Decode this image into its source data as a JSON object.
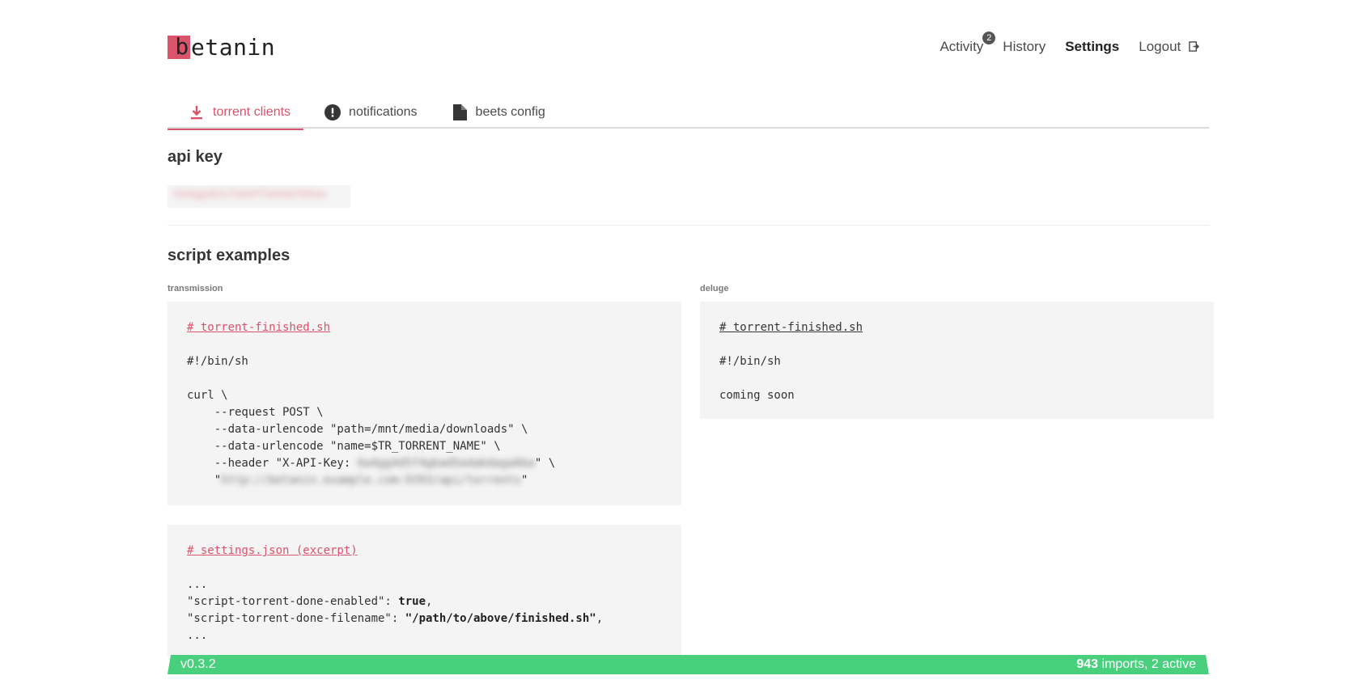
{
  "logo": {
    "first_letter": "b",
    "rest": "etanin"
  },
  "nav": {
    "activity": "Activity",
    "activity_badge": "2",
    "history": "History",
    "settings": "Settings",
    "logout": "Logout"
  },
  "tabs": [
    {
      "label": "torrent clients",
      "icon": "download-icon",
      "active": true
    },
    {
      "label": "notifications",
      "icon": "alert-circle-icon",
      "active": false
    },
    {
      "label": "beets config",
      "icon": "file-icon",
      "active": false
    }
  ],
  "api_key": {
    "heading": "api key",
    "value": "6a4ggab1c5ab4f5a6abfb6aa"
  },
  "script_examples": {
    "heading": "script examples",
    "transmission": {
      "label": "transmission",
      "finished_comment": "# torrent-finished.sh",
      "shebang": "#!/bin/sh",
      "lines": [
        "curl \\",
        "    --request POST \\",
        "    --data-urlencode \"path=/mnt/media/downloads\" \\",
        "    --data-urlencode \"name=$TR_TORRENT_NAME\" \\"
      ],
      "header_prefix": "    --header \"X-API-Key: ",
      "header_key_blurred": "6a4gg4d5f4gbad5adabdaga6ba",
      "header_suffix": "\" \\",
      "url_prefix": "    \"",
      "url_blurred": "http://betanin.example.com:9393/api/torrents",
      "url_suffix": "\"",
      "settings_comment": "# settings.json (excerpt)",
      "settings_lines": {
        "ellipsis_top": "...",
        "enabled_key": "\"script-torrent-done-enabled\": ",
        "enabled_val": "true",
        "filename_key": "\"script-torrent-done-filename\": ",
        "filename_val": "\"/path/to/above/finished.sh\"",
        "ellipsis_bottom": "..."
      }
    },
    "deluge": {
      "label": "deluge",
      "finished_comment": "# torrent-finished.sh",
      "shebang": "#!/bin/sh",
      "body": "coming soon"
    }
  },
  "footer": {
    "version": "v0.3.2",
    "imports_count": "943",
    "imports_text": " imports, 2 active"
  },
  "colors": {
    "accent": "#d9536a",
    "footer": "#48d07c"
  }
}
